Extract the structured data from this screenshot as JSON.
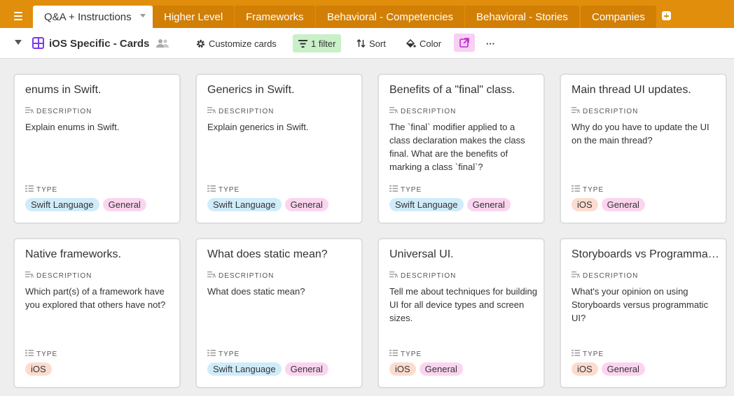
{
  "tabs": {
    "active": "Q&A + Instructions",
    "items": [
      "Higher Level",
      "Frameworks",
      "Behavioral - Competencies",
      "Behavioral - Stories",
      "Companies"
    ]
  },
  "toolbar": {
    "view_name": "iOS Specific - Cards",
    "customize": "Customize cards",
    "filter": "1 filter",
    "sort": "Sort",
    "color": "Color",
    "more": "···"
  },
  "fields": {
    "description": "DESCRIPTION",
    "type": "TYPE"
  },
  "tag_colors": {
    "Swift Language": "#d0ecfa",
    "General": "#fbd5ef",
    "iOS": "#fcdccf"
  },
  "cards": [
    {
      "title": "enums in Swift.",
      "description": "Explain enums in Swift.",
      "tags": [
        "Swift Language",
        "General"
      ]
    },
    {
      "title": "Generics in Swift.",
      "description": "Explain generics in Swift.",
      "tags": [
        "Swift Language",
        "General"
      ]
    },
    {
      "title": "Benefits of a \"final\" class.",
      "description": "The `final` modifier applied to a class declaration makes the class final. What are the benefits of marking a class `final`?",
      "tags": [
        "Swift Language",
        "General"
      ]
    },
    {
      "title": "Main thread UI updates.",
      "description": "Why do you have to update the UI on the main thread?",
      "tags": [
        "iOS",
        "General"
      ]
    },
    {
      "title": "Native frameworks.",
      "description": "Which part(s) of a framework have you explored that others have not?",
      "tags": [
        "iOS"
      ]
    },
    {
      "title": "What does static mean?",
      "description": "What does static mean?",
      "tags": [
        "Swift Language",
        "General"
      ]
    },
    {
      "title": "Universal UI.",
      "description": "Tell me about techniques for building UI for all device types and screen sizes.",
      "tags": [
        "iOS",
        "General"
      ]
    },
    {
      "title": "Storyboards vs Programmatic UI.",
      "description": "What's your opinion on using Storyboards versus programmatic UI?",
      "tags": [
        "iOS",
        "General"
      ]
    }
  ]
}
